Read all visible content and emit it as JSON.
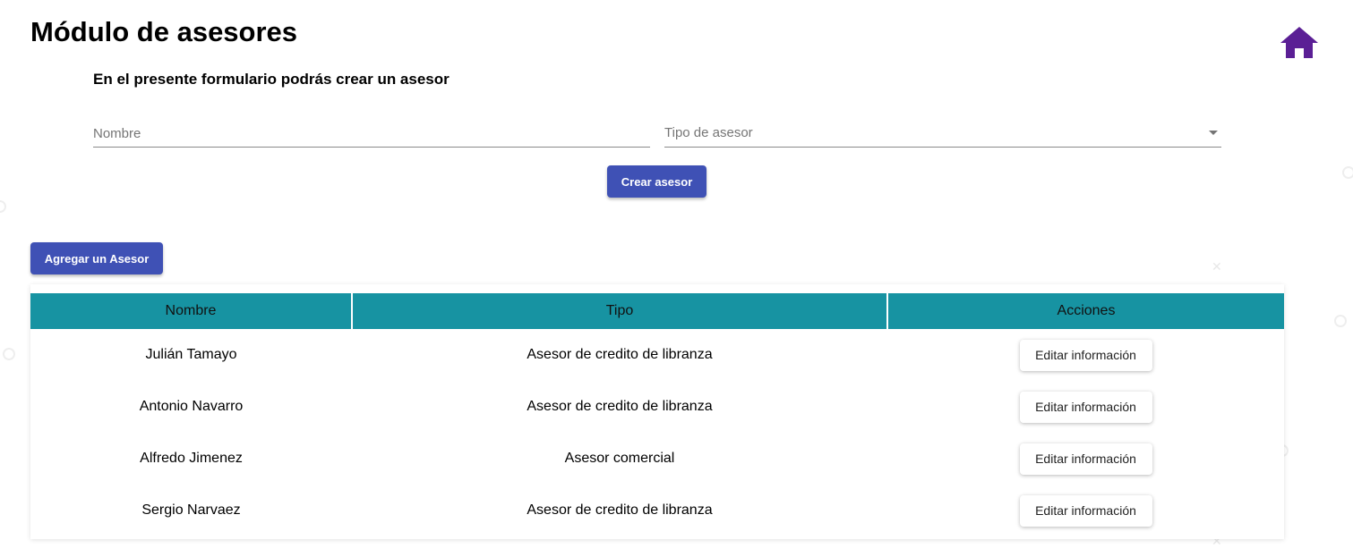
{
  "header": {
    "title": "Módulo de asesores",
    "home_icon": "home-icon",
    "home_color": "#5b1f95"
  },
  "form": {
    "subtitle": "En el presente formulario podrás crear un asesor",
    "nombre_placeholder": "Nombre",
    "nombre_value": "",
    "tipo_placeholder": "Tipo de asesor",
    "submit_label": "Crear asesor"
  },
  "add_button_label": "Agregar un Asesor",
  "table": {
    "headers": [
      "Nombre",
      "Tipo",
      "Acciones"
    ],
    "header_color": "#1793a2",
    "rows": [
      {
        "nombre": "Julián Tamayo",
        "tipo": "Asesor de credito de libranza",
        "accion": "Editar información"
      },
      {
        "nombre": "Antonio Navarro",
        "tipo": "Asesor de credito de libranza",
        "accion": "Editar información"
      },
      {
        "nombre": "Alfredo Jimenez",
        "tipo": "Asesor comercial",
        "accion": "Editar información"
      },
      {
        "nombre": "Sergio Narvaez",
        "tipo": "Asesor de credito de libranza",
        "accion": "Editar información"
      }
    ]
  },
  "colors": {
    "primary": "#3f51b5"
  }
}
